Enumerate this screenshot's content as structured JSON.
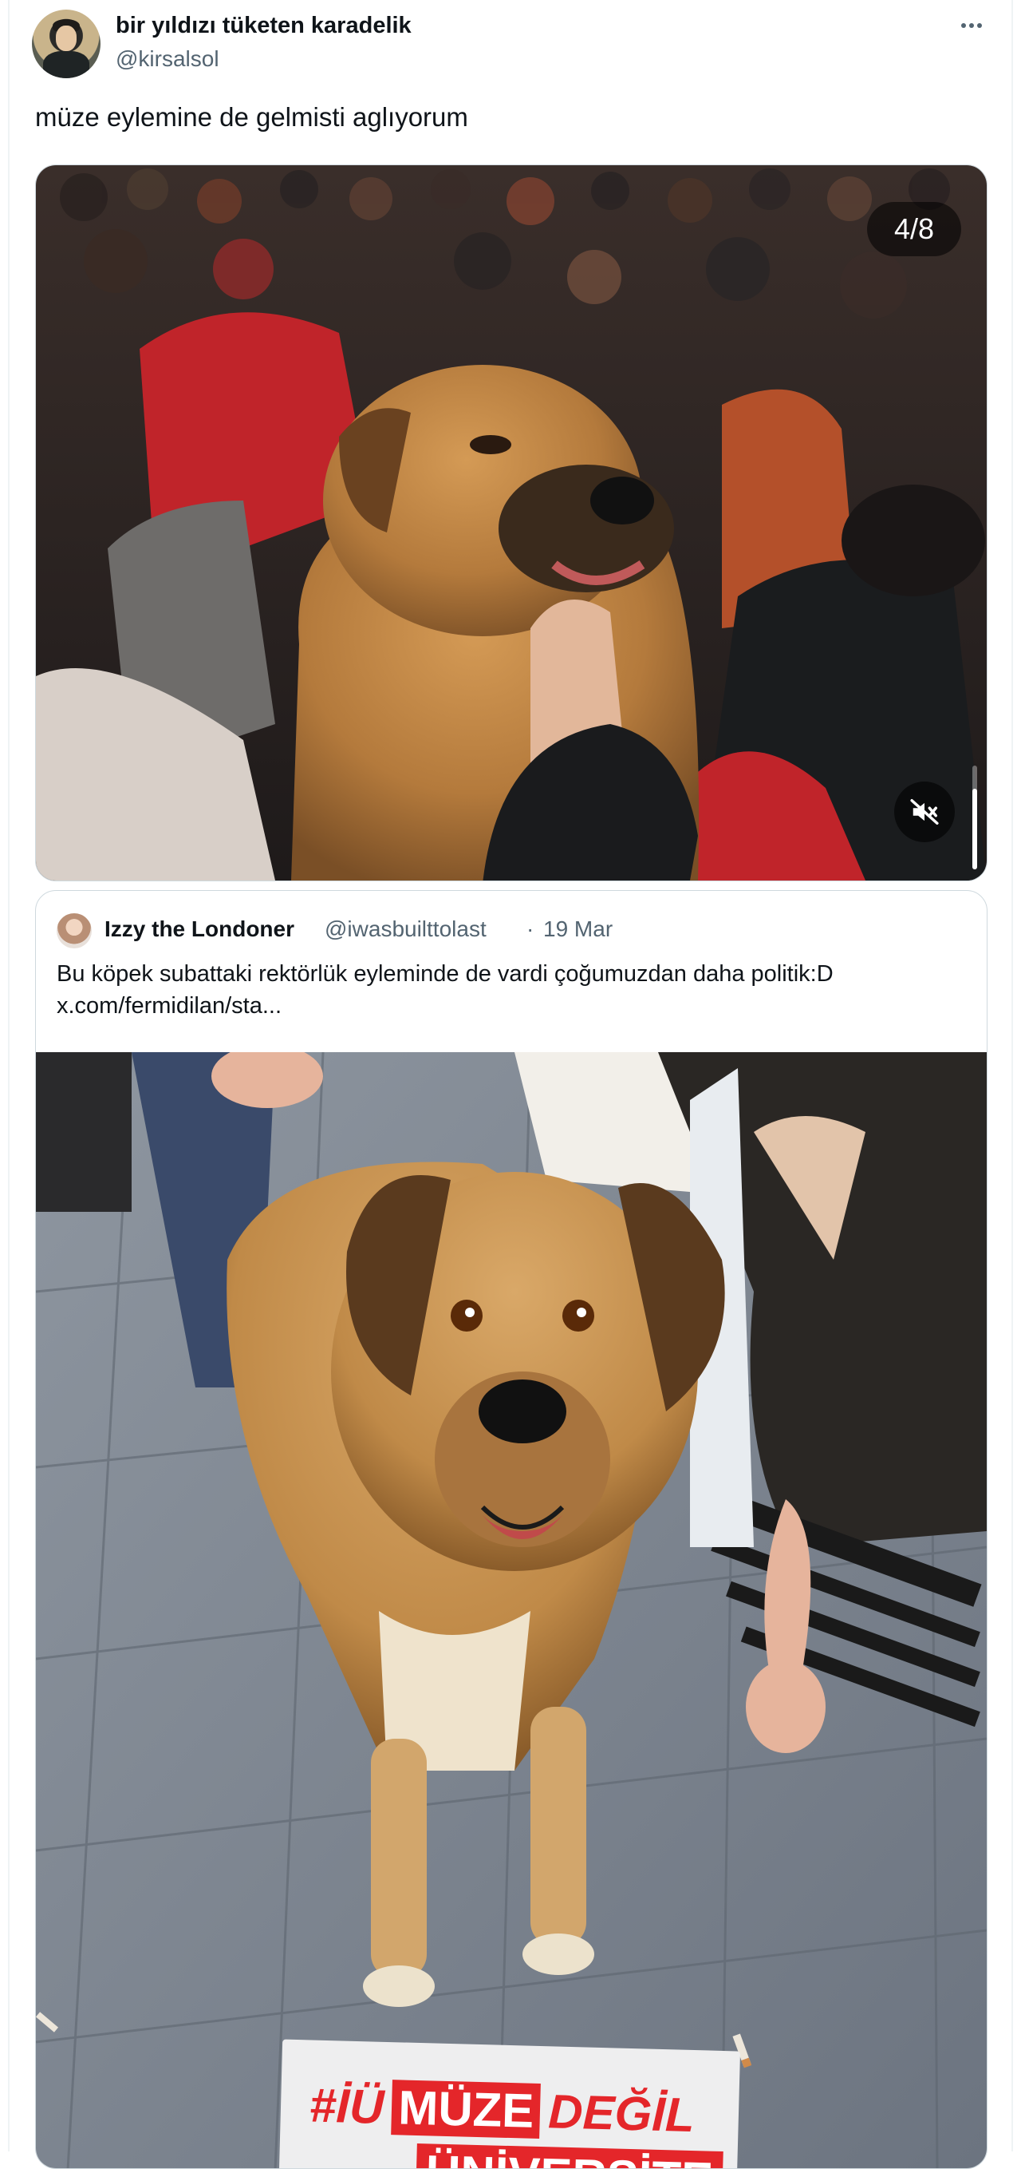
{
  "tweet": {
    "display_name": "bir yıldızı tüketen karadelik",
    "handle": "@kirsalsol",
    "text": "müze eylemine de gelmisti aglıyorum",
    "more_icon": "more-horizontal-icon",
    "media": {
      "counter": "4/8",
      "mute_icon": "volume-muted-icon",
      "progress": 0.78
    }
  },
  "quote": {
    "display_name": "Izzy the Londoner",
    "handle": "@iwasbuilttolast",
    "separator": "·",
    "date": "19 Mar",
    "text_line1": "Bu köpek subattaki rektörlük eyleminde de vardi çoğumuzdan daha politik:D",
    "text_line2": "x.com/fermidilan/sta...",
    "poster": {
      "hash": "#İÜ",
      "word1": "MÜZE",
      "word2": "DEĞİL",
      "word3": "ÜNİVERSİTE"
    }
  },
  "colors": {
    "text_primary": "#0f1419",
    "text_secondary": "#536471",
    "border": "#cfd9de",
    "poster_red": "#e4262a"
  }
}
